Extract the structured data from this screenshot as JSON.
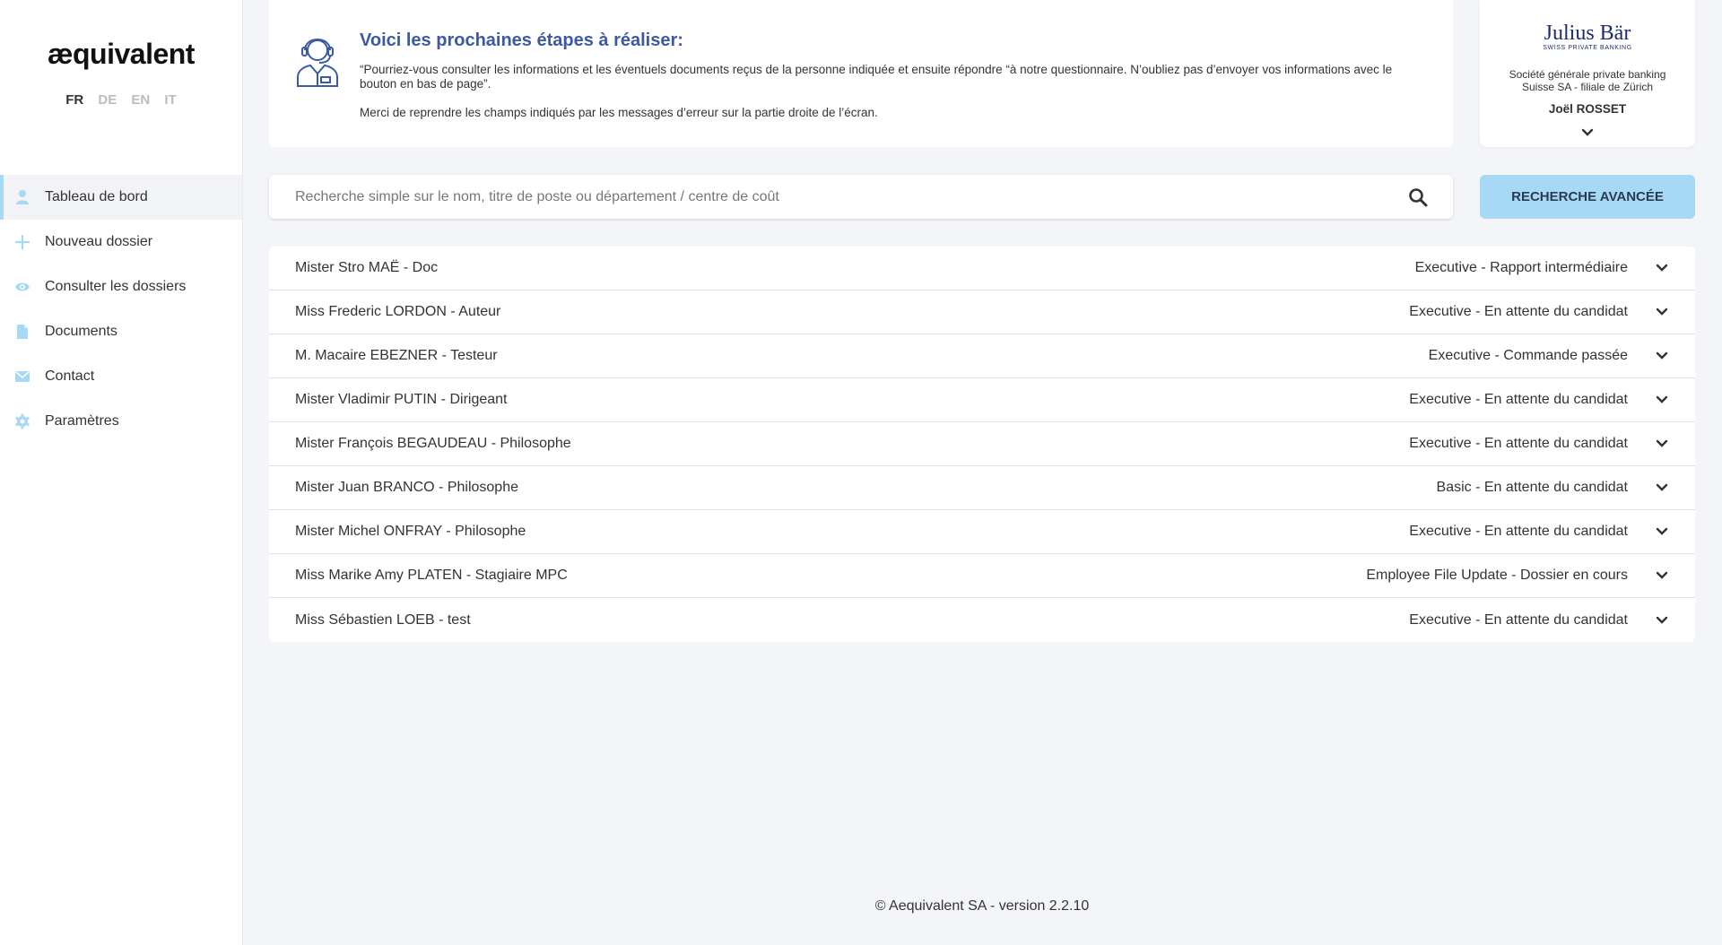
{
  "brand": {
    "logo_text": "æquivalent"
  },
  "languages": [
    {
      "label": "FR",
      "active": true
    },
    {
      "label": "DE",
      "active": false
    },
    {
      "label": "EN",
      "active": false
    },
    {
      "label": "IT",
      "active": false
    }
  ],
  "sidebar": {
    "items": [
      {
        "label": "Tableau de bord",
        "icon": "user-icon",
        "active": true
      },
      {
        "label": "Nouveau dossier",
        "icon": "plus-icon",
        "active": false
      },
      {
        "label": "Consulter les dossiers",
        "icon": "eye-icon",
        "active": false
      },
      {
        "label": "Documents",
        "icon": "document-icon",
        "active": false
      },
      {
        "label": "Contact",
        "icon": "mail-icon",
        "active": false
      },
      {
        "label": "Paramètres",
        "icon": "gear-icon",
        "active": false
      }
    ]
  },
  "info": {
    "icon": "support-agent-icon",
    "title": "Voici les prochaines étapes à réaliser:",
    "text": "“Pourriez-vous consulter les informations et les éventuels documents reçus de la personne indiquée et ensuite répondre “à notre questionnaire. N’oubliez pas d’envoyer vos informations avec le bouton en bas de page”.",
    "text2": "Merci de reprendre les champs indiqués par les messages d’erreur sur la partie droite de l’écran."
  },
  "company": {
    "brand_name": "Julius Bär",
    "brand_sub": "SWISS PRIVATE BANKING",
    "name": "Société générale private banking Suisse SA - filiale de Zürich",
    "user": "Joël ROSSET"
  },
  "search": {
    "placeholder": "Recherche simple sur le nom, titre de poste ou département / centre de coût",
    "value": "",
    "advanced_label": "RECHERCHE AVANCÉE"
  },
  "dossiers": [
    {
      "name": "Mister Stro MAË - Doc",
      "status": "Executive - Rapport intermédiaire"
    },
    {
      "name": "Miss Frederic LORDON - Auteur",
      "status": "Executive - En attente du candidat"
    },
    {
      "name": "M. Macaire EBEZNER - Testeur",
      "status": "Executive - Commande passée"
    },
    {
      "name": "Mister Vladimir PUTIN - Dirigeant",
      "status": "Executive - En attente du candidat"
    },
    {
      "name": "Mister François BEGAUDEAU - Philosophe",
      "status": "Executive - En attente du candidat"
    },
    {
      "name": "Mister Juan BRANCO - Philosophe",
      "status": "Basic - En attente du candidat"
    },
    {
      "name": "Mister Michel ONFRAY - Philosophe",
      "status": "Executive - En attente du candidat"
    },
    {
      "name": "Miss Marike Amy PLATEN - Stagiaire MPC",
      "status": "Employee File Update - Dossier en cours"
    },
    {
      "name": "Miss Sébastien LOEB - test",
      "status": "Executive - En attente du candidat"
    }
  ],
  "footer": {
    "text": "© Aequivalent SA - version 2.2.10"
  },
  "colors": {
    "accent": "#a6d9f5",
    "title_blue": "#3b5aa3",
    "brand_navy": "#1e2c6b"
  }
}
